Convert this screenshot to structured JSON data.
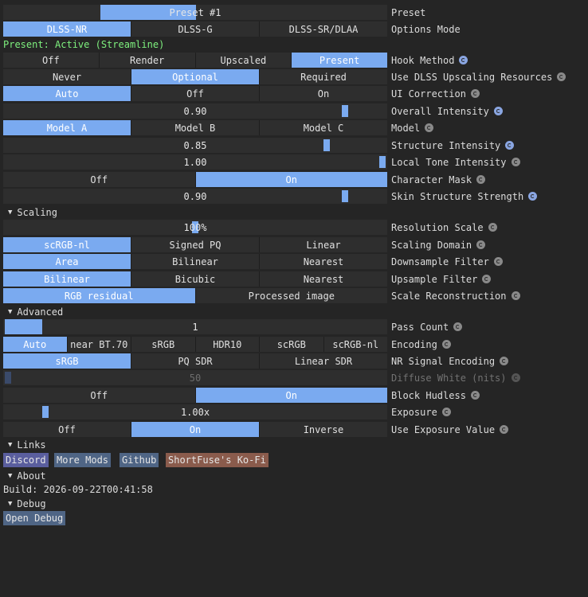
{
  "preset": {
    "value": "Preset #1",
    "label": "Preset"
  },
  "options_mode": {
    "options": [
      "DLSS-NR",
      "DLSS-G",
      "DLSS-SR/DLAA"
    ],
    "selected": 0,
    "label": "Options Mode"
  },
  "status": "Present: Active (Streamline)",
  "hook_method": {
    "options": [
      "Off",
      "Render",
      "Upscaled",
      "Present"
    ],
    "selected": 3,
    "label": "Hook Method"
  },
  "use_dlss_upscaling": {
    "options": [
      "Never",
      "Optional",
      "Required"
    ],
    "selected": 1,
    "label": "Use DLSS Upscaling Resources"
  },
  "ui_correction": {
    "options": [
      "Auto",
      "Off",
      "On"
    ],
    "selected": 0,
    "label": "UI Correction"
  },
  "overall_intensity": {
    "value": "0.90",
    "fraction": 0.9,
    "label": "Overall Intensity"
  },
  "model": {
    "options": [
      "Model A",
      "Model B",
      "Model C"
    ],
    "selected": 0,
    "label": "Model"
  },
  "structure_intensity": {
    "value": "0.85",
    "fraction": 0.85,
    "label": "Structure Intensity"
  },
  "local_tone_intensity": {
    "value": "1.00",
    "fraction": 1.0,
    "label": "Local Tone Intensity"
  },
  "character_mask": {
    "options": [
      "Off",
      "On"
    ],
    "selected": 1,
    "label": "Character Mask"
  },
  "skin_structure_strength": {
    "value": "0.90",
    "fraction": 0.9,
    "label": "Skin Structure Strength"
  },
  "scaling": {
    "header": "Scaling",
    "resolution_scale": {
      "value": "100%",
      "fraction": 0.5,
      "label": "Resolution Scale"
    },
    "scaling_domain": {
      "options": [
        "scRGB-nl",
        "Signed PQ",
        "Linear"
      ],
      "selected": 0,
      "label": "Scaling Domain"
    },
    "downsample_filter": {
      "options": [
        "Area",
        "Bilinear",
        "Nearest"
      ],
      "selected": 0,
      "label": "Downsample Filter"
    },
    "upsample_filter": {
      "options": [
        "Bilinear",
        "Bicubic",
        "Nearest"
      ],
      "selected": 0,
      "label": "Upsample Filter"
    },
    "scale_reconstruction": {
      "options": [
        "RGB residual",
        "Processed image"
      ],
      "selected": 0,
      "label": "Scale Reconstruction"
    }
  },
  "advanced": {
    "header": "Advanced",
    "pass_count": {
      "value": "1",
      "fraction": 0.1,
      "label": "Pass Count"
    },
    "encoding": {
      "options": [
        "Auto",
        "near BT.70",
        "sRGB",
        "HDR10",
        "scRGB",
        "scRGB-nl"
      ],
      "selected": 0,
      "label": "Encoding"
    },
    "nr_signal_encoding": {
      "options": [
        "sRGB",
        "PQ SDR",
        "Linear SDR"
      ],
      "selected": 0,
      "label": "NR Signal Encoding"
    },
    "diffuse_white": {
      "value": "50",
      "fraction": 0.0,
      "label": "Diffuse White (nits)"
    },
    "block_hudless": {
      "options": [
        "Off",
        "On"
      ],
      "selected": 1,
      "label": "Block Hudless"
    },
    "exposure": {
      "value": "1.00x",
      "fraction": 0.1,
      "label": "Exposure"
    },
    "use_exposure_value": {
      "options": [
        "Off",
        "On",
        "Inverse"
      ],
      "selected": 1,
      "label": "Use Exposure Value"
    }
  },
  "links": {
    "header": "Links",
    "buttons": [
      {
        "label": "Discord",
        "color": "#5a5e9e"
      },
      {
        "label": "More Mods",
        "color": "#4f6585"
      },
      {
        "label": "Github",
        "color": "#4f6585"
      },
      {
        "label": "ShortFuse's Ko-Fi",
        "color": "#8a5b4c"
      }
    ]
  },
  "about": {
    "header": "About",
    "build": "Build: 2026-09-22T00:41:58"
  },
  "debug": {
    "header": "Debug",
    "button": "Open Debug"
  },
  "colors": {
    "accent": "#7aaaf0",
    "status_green": "#7ef07e",
    "background": "#252525",
    "control_bg": "#2e2e2e"
  }
}
